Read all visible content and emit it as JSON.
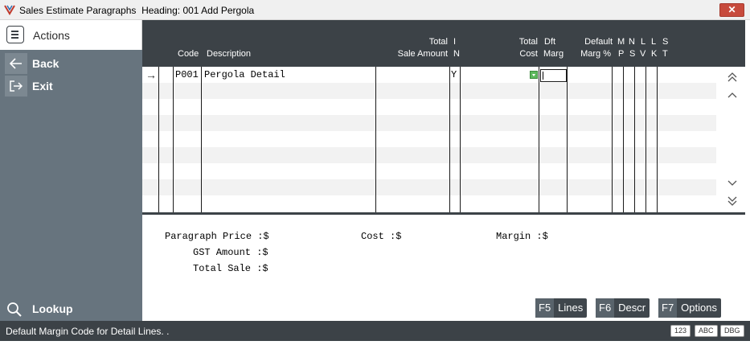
{
  "window": {
    "title": "Sales Estimate Paragraphs  Heading: 001 Add Pergola",
    "close_label": "✕"
  },
  "sidebar": {
    "actions_label": "Actions",
    "items": [
      {
        "label": "Back",
        "icon": "arrow-left-icon"
      },
      {
        "label": "Exit",
        "icon": "exit-icon"
      }
    ],
    "lookup_label": "Lookup"
  },
  "grid": {
    "headers": {
      "code": "Code",
      "description": "Description",
      "total_sale_amount_1": "Total",
      "total_sale_amount_2": "Sale Amount",
      "in_1": "I",
      "in_2": "N",
      "total_cost_1": "Total",
      "total_cost_2": "Cost",
      "dft_marg_1": "Dft",
      "dft_marg_2": "Marg",
      "default_marg_1": "Default",
      "default_marg_2": "Marg %",
      "mp_1": "M",
      "mp_2": "P",
      "ns_1": "N",
      "ns_2": "S",
      "lv_1": "L",
      "lv_2": "V",
      "lk_1": "L",
      "lk_2": "K",
      "st_1": "S",
      "st_2": "T"
    },
    "rows": [
      {
        "code": "P001",
        "description": "Pergola Detail",
        "in": "Y"
      }
    ]
  },
  "totals": {
    "paragraph_price": "Paragraph Price :$",
    "cost": "Cost :$",
    "margin": "Margin :$",
    "gst_amount": "GST Amount :$",
    "total_sale": "Total Sale :$"
  },
  "function_keys": [
    {
      "key": "F5",
      "label": "Lines"
    },
    {
      "key": "F6",
      "label": "Descr"
    },
    {
      "key": "F7",
      "label": "Options"
    }
  ],
  "status": {
    "message": "Default Margin Code for Detail Lines. .",
    "indicators": [
      "123",
      "ABC",
      "DBG"
    ]
  },
  "colors": {
    "header_bg": "#3c4247",
    "sidebar_bg": "#67747e",
    "close_red": "#c74a3c",
    "row_stripe": "#f2f2f2"
  }
}
